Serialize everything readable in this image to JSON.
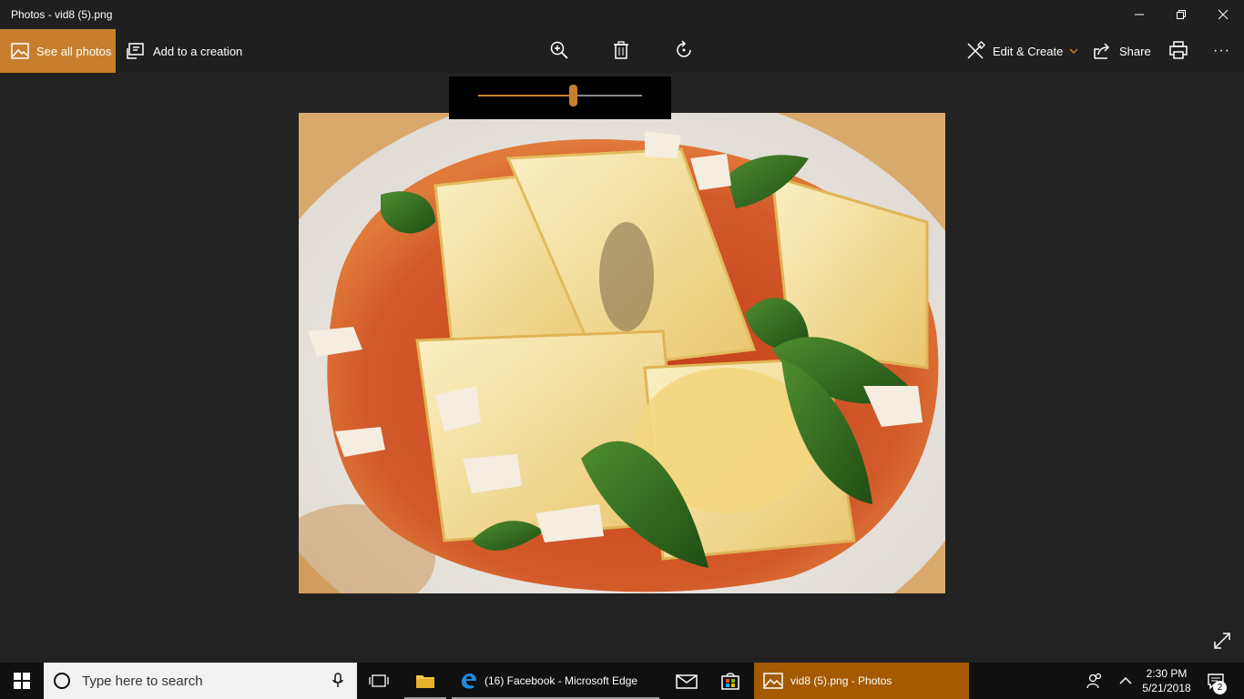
{
  "window": {
    "title": "Photos - vid8 (5).png"
  },
  "toolbar": {
    "see_all_label": "See all photos",
    "add_creation_label": "Add to a creation",
    "edit_create_label": "Edit & Create",
    "share_label": "Share",
    "more_label": "···"
  },
  "zoom": {
    "level_fraction": 0.58
  },
  "taskbar": {
    "search_placeholder": "Type here to search",
    "edge_label": "(16) Facebook - Microsoft Edge",
    "photos_label": "vid8 (5).png - Photos",
    "time": "2:30 PM",
    "date": "5/21/2018",
    "notification_count": "2"
  },
  "colors": {
    "accent": "#c77f2e",
    "taskbar_active": "#a35a00",
    "background": "#222222"
  }
}
